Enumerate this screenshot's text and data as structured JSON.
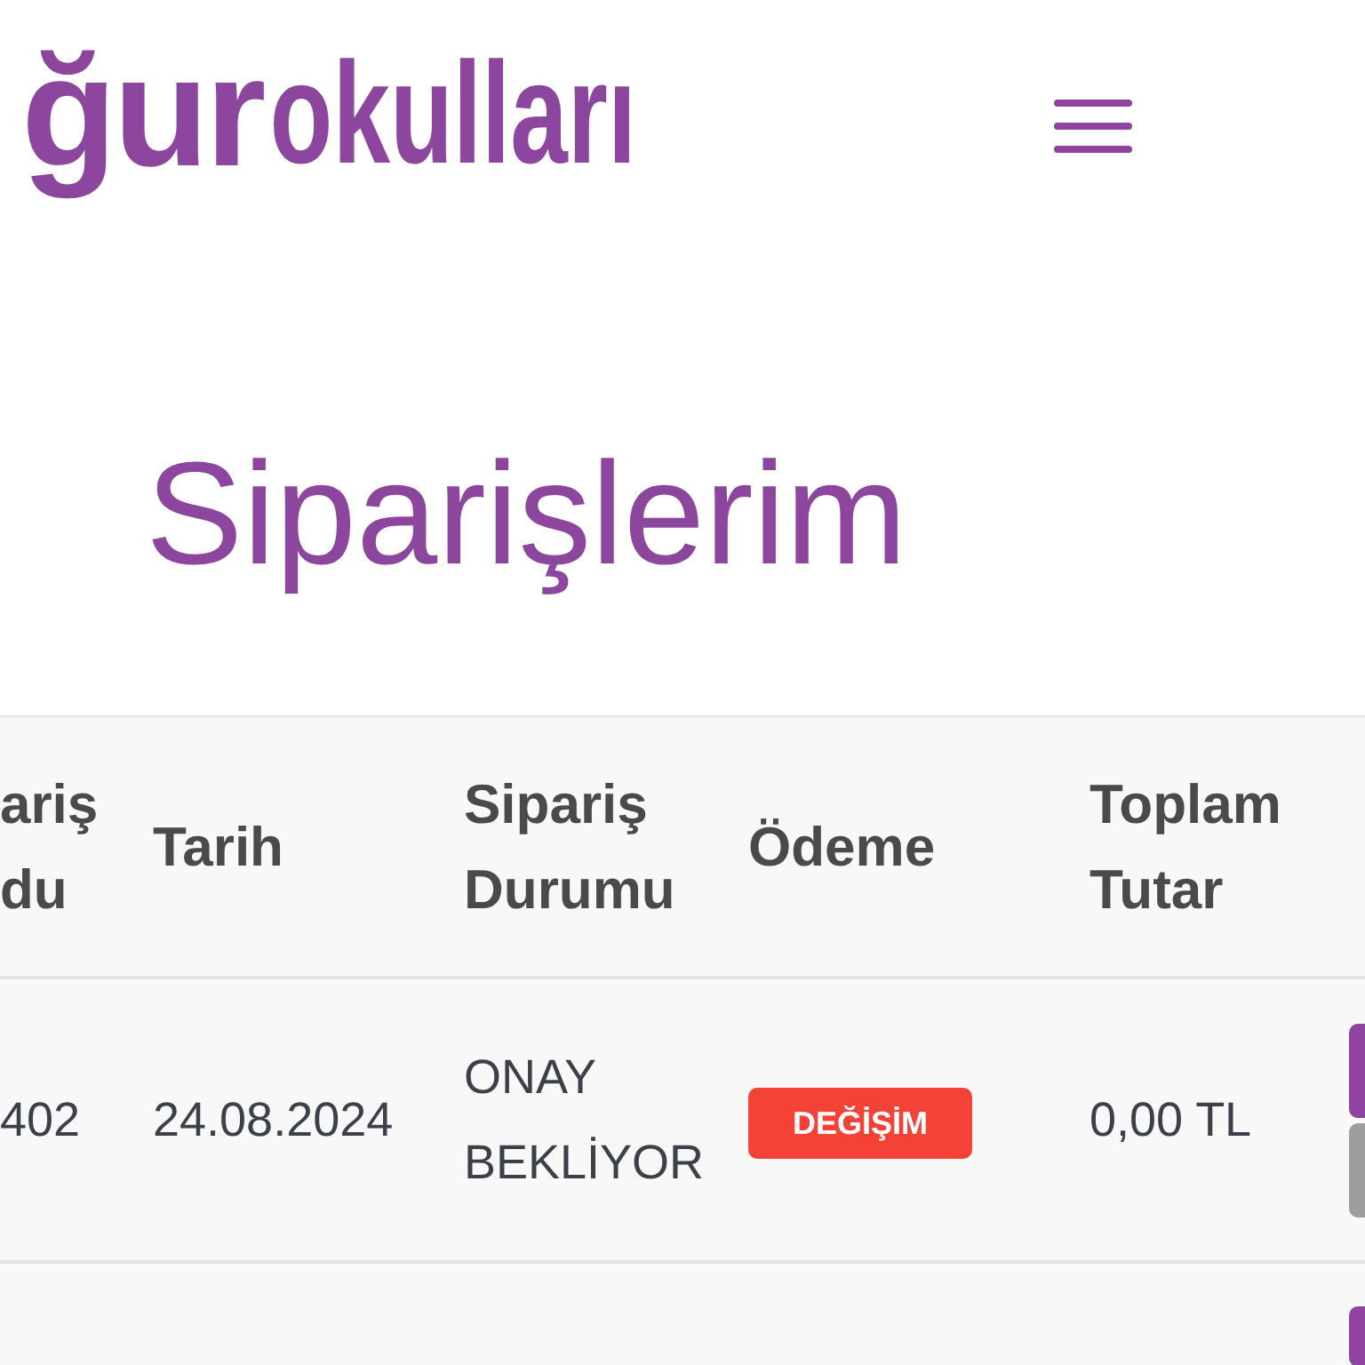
{
  "header": {
    "logo": {
      "name": "ğur",
      "suffix": "okulları"
    }
  },
  "page_title": "Siparişlerim",
  "table": {
    "columns": [
      "ariş du",
      "Tarih",
      "Sipariş Durumu",
      "Ödeme",
      "Toplam Tutar"
    ],
    "rows": [
      {
        "cells": [
          {
            "kind": "text",
            "text": "402"
          },
          {
            "kind": "text",
            "text": "24.08.2024"
          },
          {
            "kind": "text",
            "text": "ONAY BEKLİYOR"
          },
          {
            "kind": "badge",
            "text": "DEĞİŞİM",
            "color": "#f44336"
          },
          {
            "kind": "text",
            "text": "0,00 TL"
          }
        ],
        "actions": [
          {
            "kind": "primary"
          },
          {
            "kind": "secondary"
          }
        ]
      },
      {
        "actions": [
          {
            "kind": "primary"
          }
        ]
      }
    ]
  }
}
